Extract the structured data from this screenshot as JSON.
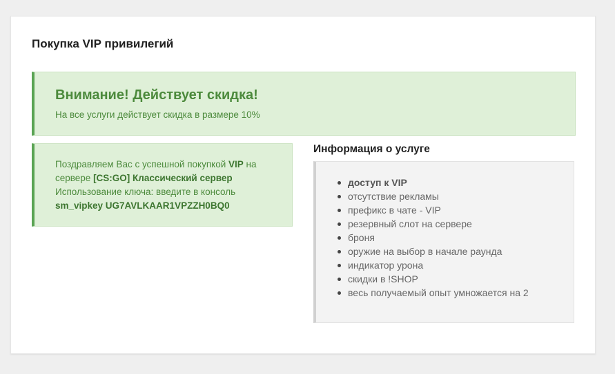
{
  "page": {
    "title": "Покупка VIP привилегий"
  },
  "discount_alert": {
    "heading": "Внимание! Действует скидка!",
    "text": "На все услуги действует скидка в размере 10%"
  },
  "success_alert": {
    "line1_prefix": "Поздравляем Вас с успешной покупкой ",
    "privilege": "VIP",
    "line1_suffix": " на",
    "line2_prefix": "сервере ",
    "server": "[CS:GO] Классический сервер",
    "line3": "Использование ключа: введите в консоль",
    "key_command": "sm_vipkey UG7AVLKAAR1VPZZH0BQ0"
  },
  "info": {
    "title": "Информация о услуге",
    "items": [
      "доступ к VIP",
      "отсутствие рекламы",
      "префикс в чате - VIP",
      "резервный слот на сервере",
      "броня",
      "оружие на выбор в начале раунда",
      "индикатор урона",
      "скидки в !SHOP",
      "весь получаемый опыт умножается на 2"
    ]
  },
  "colors": {
    "background": "#efefef",
    "success_bg": "#dff0d8",
    "success_text": "#4c8a3c",
    "success_border": "#5aa454",
    "info_bg": "#f3f3f3"
  }
}
